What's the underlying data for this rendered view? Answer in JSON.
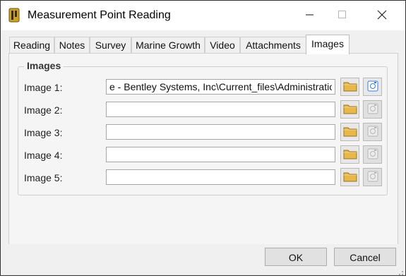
{
  "window": {
    "title": "Measurement Point Reading",
    "icons": {
      "app": "measurement-app-icon",
      "minimize": "minimize-icon",
      "maximize": "maximize-icon",
      "close": "close-icon"
    }
  },
  "tabs": [
    {
      "label": "Reading"
    },
    {
      "label": "Notes"
    },
    {
      "label": "Survey"
    },
    {
      "label": "Marine Growth"
    },
    {
      "label": "Video"
    },
    {
      "label": "Attachments"
    },
    {
      "label": "Images",
      "active": true
    }
  ],
  "images_group": {
    "title": "Images",
    "rows": [
      {
        "label": "Image 1:",
        "value": "e - Bentley Systems, Inc\\Current_files\\Administration",
        "view_enabled": true
      },
      {
        "label": "Image 2:",
        "value": "",
        "view_enabled": false
      },
      {
        "label": "Image 3:",
        "value": "",
        "view_enabled": false
      },
      {
        "label": "Image 4:",
        "value": "",
        "view_enabled": false
      },
      {
        "label": "Image 5:",
        "value": "",
        "view_enabled": false
      }
    ],
    "browse_icon": "folder-icon",
    "view_icon": "image-view-icon"
  },
  "footer": {
    "ok_label": "OK",
    "cancel_label": "Cancel"
  },
  "colors": {
    "folder": "#e8b84a",
    "view_active": "#3a7bd5",
    "view_disabled": "#b5b5b5"
  }
}
